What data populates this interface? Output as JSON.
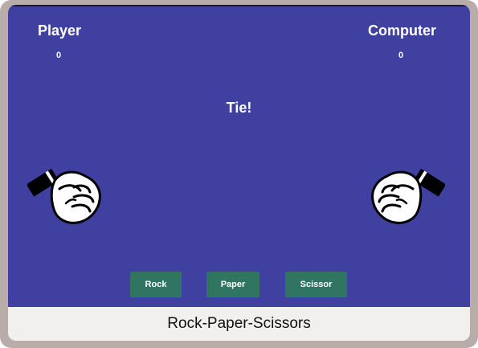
{
  "game": {
    "player_label": "Player",
    "computer_label": "Computer",
    "player_score": "0",
    "computer_score": "0",
    "result_text": "Tie!",
    "player_hand": "fist-icon",
    "computer_hand": "fist-icon"
  },
  "controls": {
    "rock_label": "Rock",
    "paper_label": "Paper",
    "scissor_label": "Scissor"
  },
  "footer": {
    "caption": "Rock-Paper-Scissors"
  },
  "colors": {
    "stage_background": "#3f40a0",
    "button_background": "#2f7561",
    "frame": "#b9ada9",
    "footer_background": "#f1f0ee"
  }
}
